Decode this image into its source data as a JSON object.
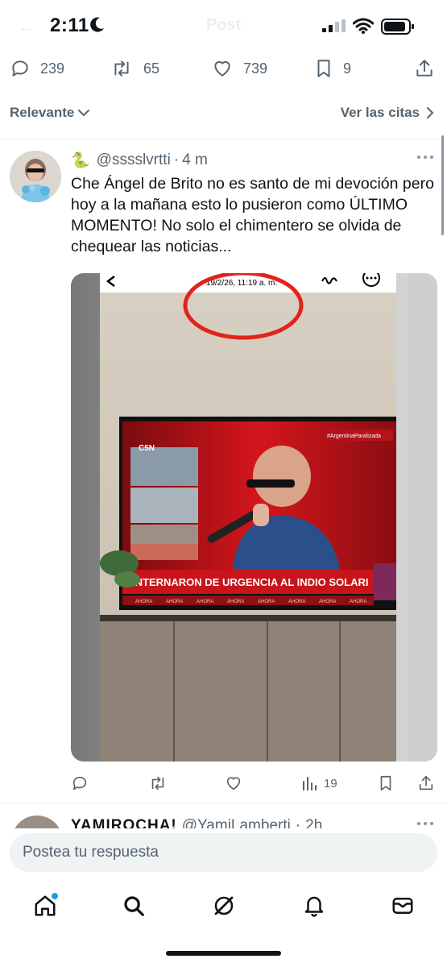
{
  "status_bar": {
    "time": "2:11",
    "background_title": "Post"
  },
  "engagement": {
    "replies": "239",
    "reposts": "65",
    "likes": "739",
    "bookmarks": "9"
  },
  "sort": {
    "left_label": "Relevante",
    "right_label": "Ver las citas"
  },
  "reply": {
    "emoji": "🐍",
    "handle": "@sssslvrtti",
    "time_ago": "4 m",
    "text": "Che Ángel de Brito no es santo de mi devoción pero hoy a la mañana esto lo pusieron como ÚLTIMO MOMENTO! No solo el chimentero se olvida de chequear las noticias...",
    "image": {
      "phone_timestamp": "19/2/26, 11:19 a. m.",
      "tv_channel": "C5N",
      "tv_hashtag": "#ArgentinaParalizada",
      "tv_headline": "INTERNARON DE URGENCIA AL INDIO SOLARI",
      "tv_ticker": "AHORA"
    },
    "views": "19"
  },
  "next_reply": {
    "name": "YAMIROCHA!",
    "handle": "@YamiLamberti",
    "time_ago": "2h"
  },
  "composer": {
    "placeholder": "Postea tu respuesta"
  },
  "nav": {
    "items": [
      "home-icon",
      "search-icon",
      "grok-icon",
      "bell-icon",
      "mail-icon"
    ],
    "notification_dot_color": "#1d9bf0"
  },
  "colors": {
    "text_secondary": "#536471",
    "accent": "#1d9bf0",
    "tv_red": "#d4161c"
  }
}
